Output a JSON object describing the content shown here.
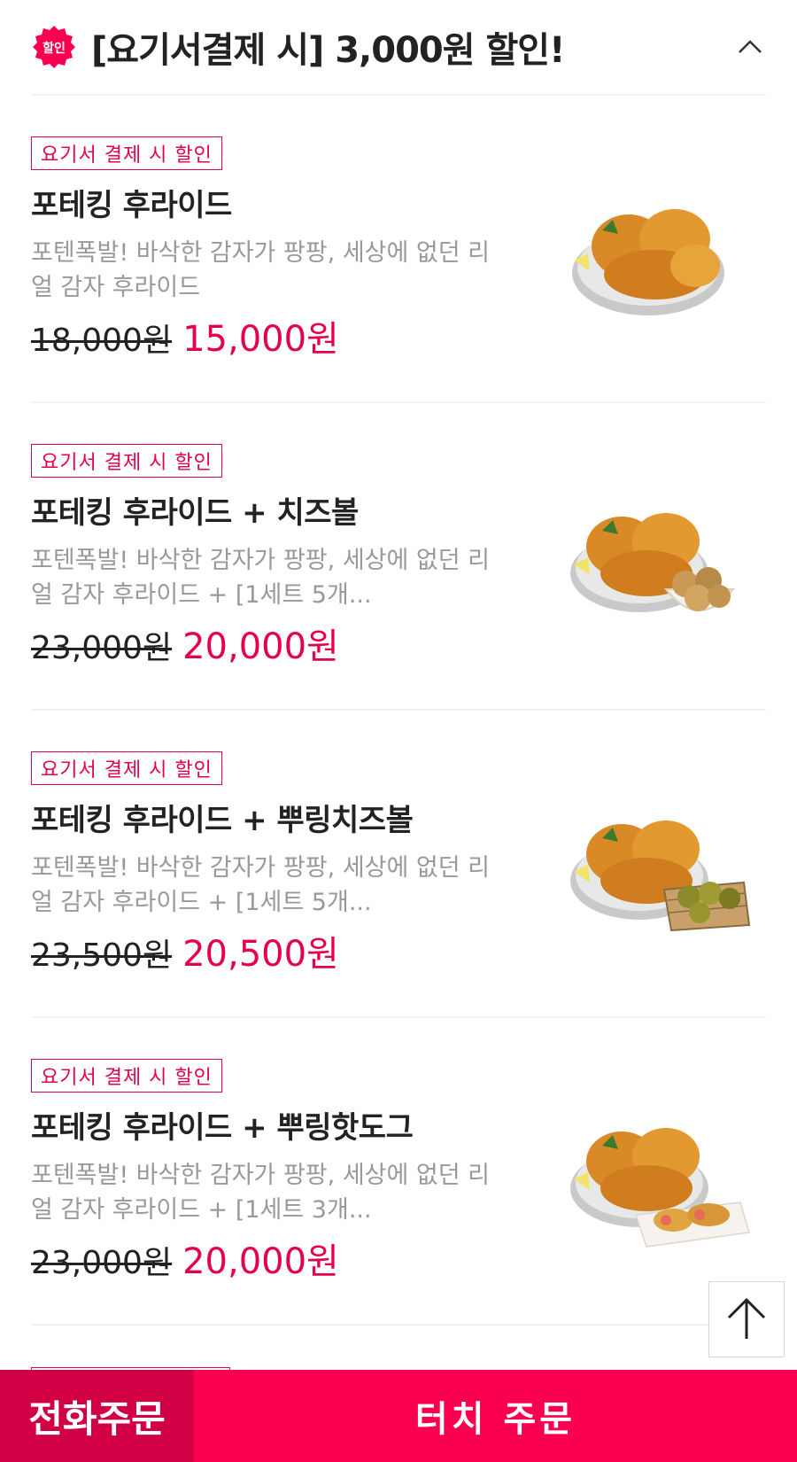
{
  "header": {
    "badge_text": "할인",
    "title": "[요기서결제 시] 3,000원 할인!"
  },
  "items": [
    {
      "tag": "요기서 결제 시 할인",
      "name": "포테킹 후라이드",
      "description": "포텐폭발! 바삭한 감자가 팡팡, 세상에 없던 리얼 감자 후라이드",
      "original_price": "18,000원",
      "sale_price": "15,000원",
      "image": "fried-chicken-plate"
    },
    {
      "tag": "요기서 결제 시 할인",
      "name": "포테킹 후라이드 + 치즈볼",
      "description": "포텐폭발! 바삭한 감자가 팡팡, 세상에 없던 리얼 감자 후라이드 + [1세트 5개...",
      "original_price": "23,000원",
      "sale_price": "20,000원",
      "image": "fried-chicken-with-cheese-balls"
    },
    {
      "tag": "요기서 결제 시 할인",
      "name": "포테킹 후라이드 + 뿌링치즈볼",
      "description": "포텐폭발! 바삭한 감자가 팡팡, 세상에 없던 리얼 감자 후라이드 + [1세트 5개...",
      "original_price": "23,500원",
      "sale_price": "20,500원",
      "image": "fried-chicken-with-bburing-cheese-balls"
    },
    {
      "tag": "요기서 결제 시 할인",
      "name": "포테킹 후라이드 + 뿌링핫도그",
      "description": "포텐폭발! 바삭한 감자가 팡팡, 세상에 없던 리얼 감자 후라이드 + [1세트 3개...",
      "original_price": "23,000원",
      "sale_price": "20,000원",
      "image": "fried-chicken-with-hotdogs"
    }
  ],
  "bottom_bar": {
    "phone_order": "전화주문",
    "touch_order": "터치 주문"
  },
  "colors": {
    "accent": "#fa0050",
    "accent_dark": "#d10045",
    "sale_text": "#e5004f"
  }
}
